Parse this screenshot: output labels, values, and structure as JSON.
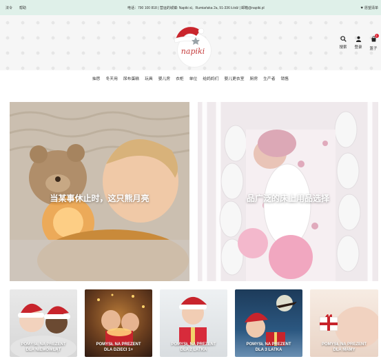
{
  "topbar": {
    "link1": "法令",
    "link2": "帮助",
    "contact": "电话：790 100 818 | 营运的城镇: Napiki sl。Rumiańska 2a, 91-336 Łódź | 邮箱@napiki.pl",
    "wishlist": "愿望清单"
  },
  "header": {
    "logo_text": "napiki",
    "icons": {
      "search": "搜索",
      "login": "登录",
      "cart": "篮子",
      "cart_count": "1"
    }
  },
  "nav": {
    "items": [
      "抽思",
      "冬天用",
      "尿布蛋糕",
      "玩具",
      "婴儿房",
      "衣柜",
      "单位",
      "给妈妈们",
      "婴儿更衣室",
      "厨房",
      "生产者",
      "销售"
    ]
  },
  "banners": [
    {
      "caption": "当某事休止时，这只熊月亮"
    },
    {
      "caption": "品广泛的床上用品选择"
    }
  ],
  "tiles": [
    {
      "label_line1": "POMYSŁ NA PREZENT",
      "label_line2": "DLA NIEMOWLĄT"
    },
    {
      "label_line1": "POMYSŁ NA PREZENT",
      "label_line2": "DLA DZIECI 1+"
    },
    {
      "label_line1": "POMYSŁ NA PREZENT",
      "label_line2": "DLA 2 LATKA"
    },
    {
      "label_line1": "POMYSŁ NA PREZENT",
      "label_line2": "DLA 3 LATKA"
    },
    {
      "label_line1": "POMYSŁ NA PREZENT",
      "label_line2": "DLA MAMY"
    }
  ],
  "colors": {
    "topbar_bg": "#dff0e9",
    "logo_red": "#c43a3a",
    "cart_badge": "#dd2233"
  }
}
